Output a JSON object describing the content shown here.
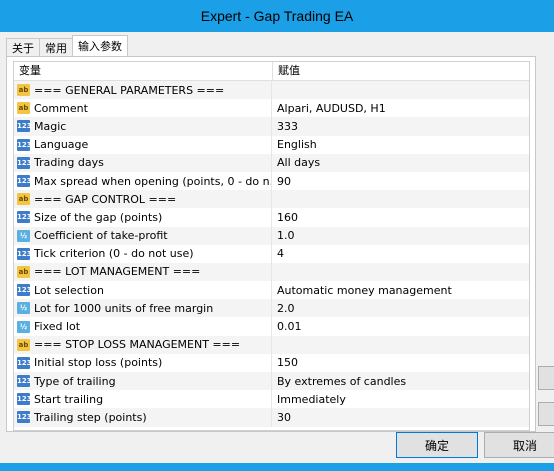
{
  "window": {
    "title": "Expert - Gap Trading EA"
  },
  "tabs": [
    {
      "label": "关于"
    },
    {
      "label": "常用"
    },
    {
      "label": "输入参数"
    }
  ],
  "grid": {
    "col_variable": "变量",
    "col_value": "赋值",
    "rows": [
      {
        "icon": "ab",
        "label": "=== GENERAL PARAMETERS ===",
        "value": ""
      },
      {
        "icon": "ab",
        "label": "Comment",
        "value": "Alpari, AUDUSD, H1"
      },
      {
        "icon": "123",
        "label": "Magic",
        "value": "333"
      },
      {
        "icon": "123",
        "label": "Language",
        "value": "English"
      },
      {
        "icon": "123",
        "label": "Trading days",
        "value": "All days"
      },
      {
        "icon": "123",
        "label": "Max spread when opening (points, 0 - do n...",
        "value": "90"
      },
      {
        "icon": "ab",
        "label": "=== GAP CONTROL ===",
        "value": ""
      },
      {
        "icon": "123",
        "label": "Size of the gap (points)",
        "value": "160"
      },
      {
        "icon": "v2",
        "label": "Coefficient of take-profit",
        "value": "1.0"
      },
      {
        "icon": "123",
        "label": "Tick criterion (0 - do not use)",
        "value": "4"
      },
      {
        "icon": "ab",
        "label": "=== LOT MANAGEMENT ===",
        "value": ""
      },
      {
        "icon": "123",
        "label": "Lot selection",
        "value": "Automatic money management"
      },
      {
        "icon": "v2",
        "label": "Lot for 1000 units of free margin",
        "value": "2.0"
      },
      {
        "icon": "v2",
        "label": "Fixed lot",
        "value": "0.01"
      },
      {
        "icon": "ab",
        "label": "=== STOP LOSS MANAGEMENT ===",
        "value": ""
      },
      {
        "icon": "123",
        "label": "Initial stop loss (points)",
        "value": "150"
      },
      {
        "icon": "123",
        "label": "Type of trailing",
        "value": "By extremes of candles"
      },
      {
        "icon": "123",
        "label": "Start trailing",
        "value": "Immediately"
      },
      {
        "icon": "123",
        "label": "Trailing step (points)",
        "value": "30"
      }
    ]
  },
  "buttons": {
    "ok": "确定",
    "cancel": "取消"
  },
  "colors": {
    "titlebar": "#1b9fe6",
    "string_icon": "#f2c545",
    "int_icon": "#3d7cc9",
    "double_icon": "#5ab0e0"
  }
}
